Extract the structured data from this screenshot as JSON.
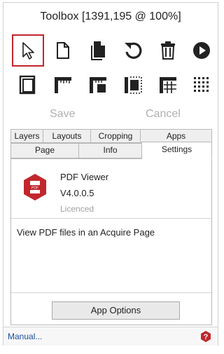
{
  "window": {
    "title": "Toolbox [1391,195 @ 100%]"
  },
  "toolbar": {
    "row1": [
      {
        "icon": "cursor-icon"
      },
      {
        "icon": "new-page-icon"
      },
      {
        "icon": "copy-page-icon"
      },
      {
        "icon": "undo-icon"
      },
      {
        "icon": "delete-icon"
      },
      {
        "icon": "play-icon"
      }
    ],
    "row2": [
      {
        "icon": "page-frame-icon"
      },
      {
        "icon": "ruler-corner-icon"
      },
      {
        "icon": "split-layout-icon"
      },
      {
        "icon": "grid-dashed-icon"
      },
      {
        "icon": "grid-lines-icon"
      },
      {
        "icon": "dot-grid-icon"
      }
    ],
    "save_label": "Save",
    "cancel_label": "Cancel"
  },
  "tabs": {
    "row1": [
      "Layers",
      "Layouts",
      "Cropping",
      "Apps"
    ],
    "row2": [
      "Page",
      "Info",
      "Settings"
    ],
    "active": "Settings"
  },
  "app": {
    "name": "PDF Viewer",
    "version": "V4.0.0.5",
    "status": "Licenced",
    "description": "View PDF files in an Acquire Page",
    "options_label": "App Options",
    "icon": "pdf-hexagon-icon"
  },
  "footer": {
    "manual_link": "Manual...",
    "help_icon": "help-icon"
  },
  "colors": {
    "accent": "#c1272d",
    "disabled_text": "#b0b0b0",
    "link": "#1a4d9e"
  }
}
